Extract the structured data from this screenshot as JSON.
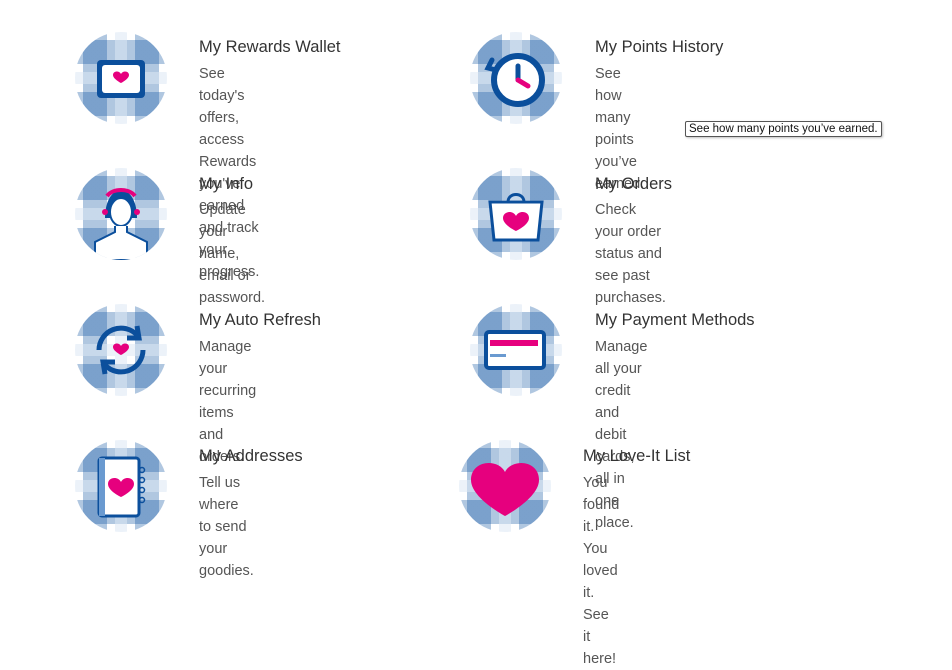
{
  "colors": {
    "brand_blue": "#0b4f9c",
    "pink": "#e6007e"
  },
  "tooltip": {
    "text": "See how many points you’ve earned."
  },
  "cards": [
    {
      "title": "My Rewards Wallet",
      "desc_line1": "See today's offers, access Rewards",
      "desc_line2": "you've earned and track your progress.",
      "icon": "wallet-icon"
    },
    {
      "title": "My Points History",
      "desc_line1": "See how many points you’ve earned.",
      "desc_line2": "",
      "icon": "clock-history-icon"
    },
    {
      "title": "My Info",
      "desc_line1": "Update your name,",
      "desc_line2": "email or password.",
      "icon": "profile-person-icon"
    },
    {
      "title": "My Orders",
      "desc_line1": "Check your order status and see past",
      "desc_line2": "purchases.",
      "icon": "shopping-bag-icon"
    },
    {
      "title": "My Auto Refresh",
      "desc_line1": "Manage your recurring",
      "desc_line2": "items and orders.",
      "icon": "refresh-heart-icon"
    },
    {
      "title": "My Payment Methods",
      "desc_line1": "Manage all your credit and debit cards,",
      "desc_line2": "all in one place.",
      "icon": "credit-card-icon"
    },
    {
      "title": "My Addresses",
      "desc_line1": "Tell us where to send",
      "desc_line2": "your goodies.",
      "icon": "address-book-icon"
    },
    {
      "title": "My Love-It List",
      "desc_line1": "You found it. You loved it. See it here!",
      "desc_line2": "",
      "icon": "heart-icon"
    }
  ]
}
